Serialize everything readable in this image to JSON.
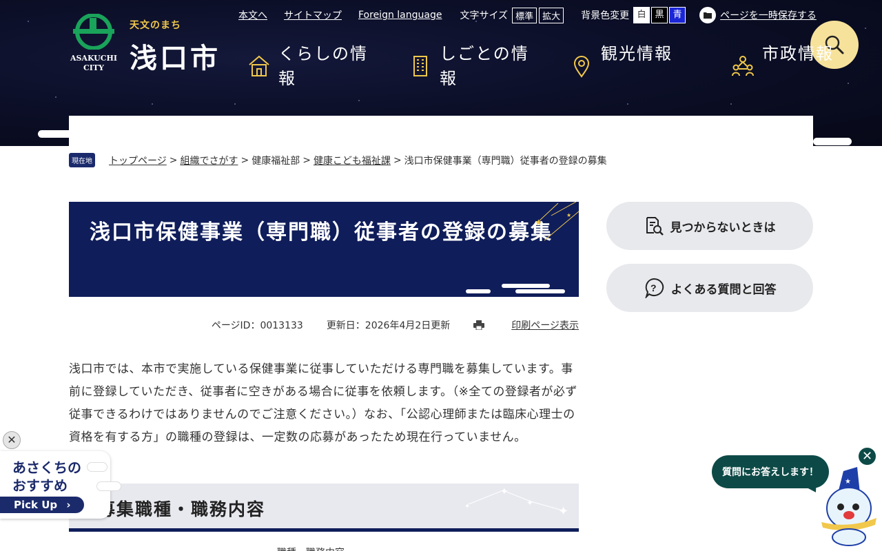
{
  "header": {
    "logo_tagline": "天文のまち",
    "logo_name": "浅口市",
    "logo_city_en": "ASAKUCHI CITY",
    "utility_links": [
      "本文へ",
      "サイトマップ",
      "Foreign language"
    ],
    "font_size_label": "文字サイズ",
    "font_size_options": [
      "標準",
      "拡大"
    ],
    "bg_color_label": "背景色変更",
    "bg_color_options": [
      "白",
      "黒",
      "青"
    ],
    "save_label": "ページを一時保存する",
    "global_nav": [
      "くらしの情報",
      "しごとの情報",
      "観光情報",
      "市政情報"
    ],
    "colors": {
      "header_bg": "#0b0e26",
      "accent_gold": "#f1c84b",
      "search_bg": "#f7e29b"
    }
  },
  "breadcrumb": {
    "badge": "現在地",
    "items": [
      {
        "label": "トップページ",
        "link": true
      },
      {
        "label": "組織でさがす",
        "link": true
      },
      {
        "label": "健康福祉部",
        "link": false
      },
      {
        "label": "健康こども福祉課",
        "link": true
      },
      {
        "label": "浅口市保健事業（専門職）従事者の登録の募集",
        "link": false
      }
    ]
  },
  "main": {
    "title": "浅口市保健事業（専門職）従事者の登録の募集",
    "page_id": "ページID：0013133",
    "updated": "更新日：2026年4月2日更新",
    "print_label": "印刷ページ表示",
    "body": "浅口市では、本市で実施している保健事業に従事していただける専門職を募集しています。事前に登録していただき、従事者に空きがある場合に従事を依頼します。（※全ての登録者が必ず従事できるわけではありませんのでご注意ください。）なお、「公認心理師または臨床心理士の資格を有する方」の職種の登録は、一定数の応募があったため現在行っていません。",
    "section_heading": "募集職種・職務内容",
    "table_hint": "職種・職務内容",
    "title_bg": "#0f1d5a"
  },
  "sidebar": {
    "not_found": "見つからないときは",
    "faq": "よくある質問と回答"
  },
  "floating": {
    "pickup_line1": "あさくちの",
    "pickup_line2": "おすすめ",
    "pickup_bar": "Pick Up",
    "pickup_close": "✕",
    "chat_text": "質問にお答えします！",
    "chat_close": "✕"
  }
}
